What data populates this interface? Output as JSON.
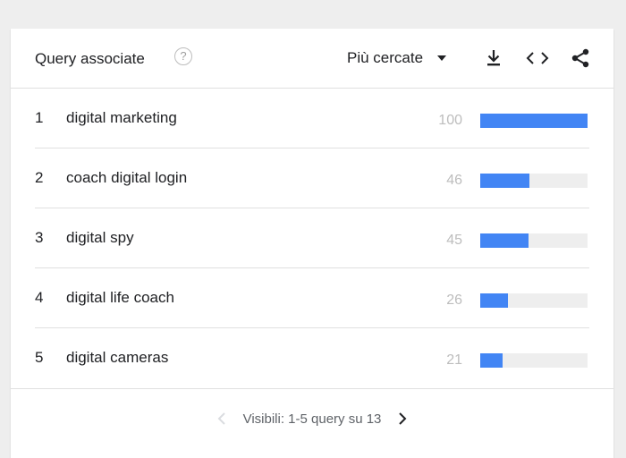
{
  "header": {
    "title": "Query associate",
    "help_glyph": "?",
    "dropdown_label": "Più cercate"
  },
  "rows": [
    {
      "rank": "1",
      "query": "digital marketing",
      "value": "100",
      "fill": 1.0
    },
    {
      "rank": "2",
      "query": "coach digital login",
      "value": "46",
      "fill": 0.46
    },
    {
      "rank": "3",
      "query": "digital spy",
      "value": "45",
      "fill": 0.45
    },
    {
      "rank": "4",
      "query": "digital life coach",
      "value": "26",
      "fill": 0.26
    },
    {
      "rank": "5",
      "query": "digital cameras",
      "value": "21",
      "fill": 0.21
    }
  ],
  "footer": {
    "pagination": "Visibili: 1-5 query su 13"
  },
  "colors": {
    "bar": "#4285f4",
    "track": "#eeeeee",
    "value_text": "#bdbdbd"
  },
  "icons": {
    "help": "help-circle-icon",
    "dropdown": "caret-down-icon",
    "download": "download-icon",
    "embed": "code-embed-icon",
    "share": "share-icon",
    "prev": "chevron-left-icon",
    "next": "chevron-right-icon"
  }
}
